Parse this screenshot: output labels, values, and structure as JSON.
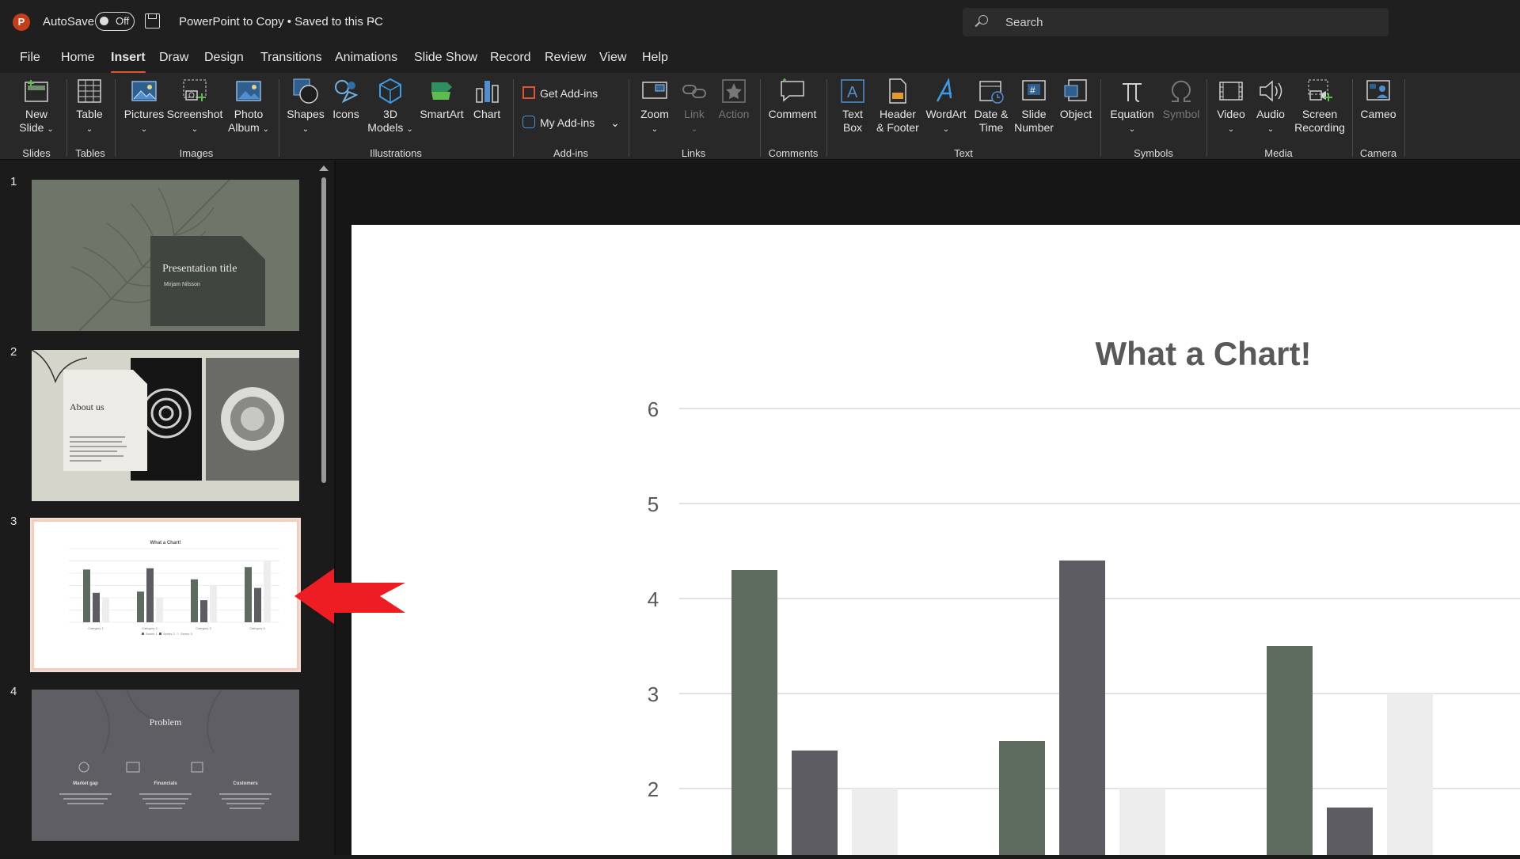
{
  "titlebar": {
    "app_icon": "powerpoint-icon",
    "autosave_label": "AutoSave",
    "autosave_state": "Off",
    "document_title": "PowerPoint to Copy • Saved to this PC",
    "search_placeholder": "Search"
  },
  "menu": {
    "tabs": [
      "File",
      "Home",
      "Insert",
      "Draw",
      "Design",
      "Transitions",
      "Animations",
      "Slide Show",
      "Record",
      "Review",
      "View",
      "Help"
    ],
    "active_tab": "Insert"
  },
  "ribbon": {
    "groups": {
      "slides": "Slides",
      "tables": "Tables",
      "images": "Images",
      "illustrations": "Illustrations",
      "addins": "Add-ins",
      "links": "Links",
      "comments": "Comments",
      "text": "Text",
      "symbols": "Symbols",
      "media": "Media",
      "camera": "Camera"
    },
    "buttons": {
      "new_slide_1": "New",
      "new_slide_2": "Slide",
      "table": "Table",
      "pictures": "Pictures",
      "screenshot": "Screenshot",
      "photo_album_1": "Photo",
      "photo_album_2": "Album",
      "shapes": "Shapes",
      "icons": "Icons",
      "models_1": "3D",
      "models_2": "Models",
      "smartart": "SmartArt",
      "chart": "Chart",
      "get_addins": "Get Add-ins",
      "my_addins": "My Add-ins",
      "zoom": "Zoom",
      "link": "Link",
      "action": "Action",
      "comment": "Comment",
      "text_box_1": "Text",
      "text_box_2": "Box",
      "header_footer_1": "Header",
      "header_footer_2": "& Footer",
      "wordart": "WordArt",
      "date_time_1": "Date &",
      "date_time_2": "Time",
      "slide_number_1": "Slide",
      "slide_number_2": "Number",
      "object": "Object",
      "equation": "Equation",
      "symbol": "Symbol",
      "video": "Video",
      "audio": "Audio",
      "screen_recording_1": "Screen",
      "screen_recording_2": "Recording",
      "cameo": "Cameo"
    }
  },
  "slides_panel": {
    "numbers": [
      "1",
      "2",
      "3",
      "4"
    ],
    "selected_slide": 3,
    "thumb1": {
      "title": "Presentation title",
      "subtitle": "Mirjam Nilsson"
    },
    "thumb2": {
      "title": "About us"
    },
    "thumb3": {
      "title": "What a Chart!",
      "categories": [
        "Category 1",
        "Category 2",
        "Category 3",
        "Category 4"
      ],
      "legend": [
        "Series 1",
        "Series 2",
        "Series 3"
      ]
    },
    "thumb4": {
      "title": "Problem",
      "columns": [
        "Market gap",
        "Financials",
        "Customers"
      ]
    }
  },
  "colors": {
    "series1": "#5e6b5f",
    "series2": "#5d5c63",
    "series3": "#ededed",
    "accent": "#e0552e",
    "annotation_arrow": "#ee1d23"
  },
  "chart_data": {
    "type": "bar",
    "title": "What a Chart!",
    "categories": [
      "Category 1",
      "Category 2",
      "Category 3",
      "Category 4"
    ],
    "series": [
      {
        "name": "Series 1",
        "values": [
          4.3,
          2.5,
          3.5,
          4.5
        ]
      },
      {
        "name": "Series 2",
        "values": [
          2.4,
          4.4,
          1.8,
          2.8
        ]
      },
      {
        "name": "Series 3",
        "values": [
          2,
          2,
          3,
          5
        ]
      }
    ],
    "ylim": [
      0,
      6
    ],
    "yticks": [
      2,
      3,
      4,
      5,
      6
    ],
    "grid": true,
    "legend": "bottom"
  }
}
